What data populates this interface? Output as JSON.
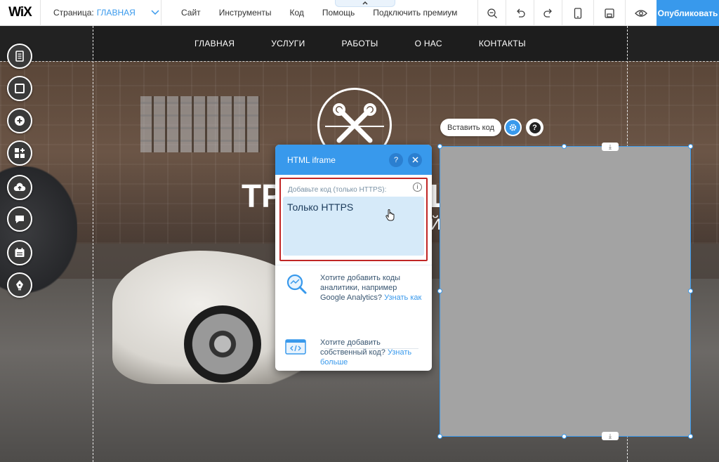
{
  "editor": {
    "logo": "WiX",
    "page_label": "Страница:",
    "page_name": "ГЛАВНАЯ",
    "menu": [
      "Сайт",
      "Инструменты",
      "Код",
      "Помощь",
      "Подключить премиум"
    ],
    "publish_label": "Опубликовать"
  },
  "site": {
    "nav": [
      "ГЛАВНАЯ",
      "УСЛУГИ",
      "РАБОТЫ",
      "О НАС",
      "КОНТАКТЫ"
    ],
    "hero_title_left": "ТР",
    "hero_title_right": "Ш",
    "hero_sub": "Й"
  },
  "element_controls": {
    "insert_code_label": "Вставить код"
  },
  "panel": {
    "title": "HTML iframe",
    "code_label": "Добавьте код (только HTTPS):",
    "code_value": "Только HTTPS",
    "promo1_text": "Хотите добавить коды аналитики, например Google Analytics?",
    "promo1_link": "Узнать как",
    "promo2_text": "Хотите добавить собственный код?",
    "promo2_link": "Узнать больше"
  },
  "colors": {
    "accent": "#3899ec",
    "highlight_border": "#c02626",
    "iframe_placeholder": "#a3a3a3"
  }
}
